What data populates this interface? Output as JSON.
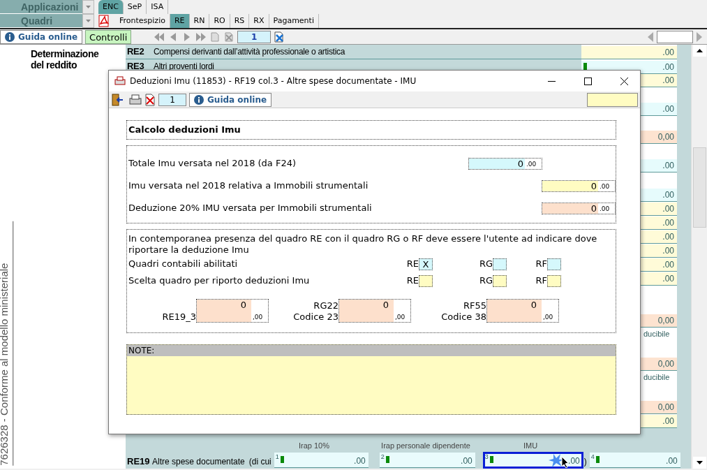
{
  "top_bar": {
    "applications_menu": "Applicazioni",
    "quadri_menu": "Quadri",
    "group_tabs": [
      {
        "label": "ENC",
        "selected": true
      },
      {
        "label": "SeP",
        "selected": false
      },
      {
        "label": "ISA",
        "selected": false
      }
    ],
    "quadro_tabs": [
      {
        "label": "Frontespizio",
        "selected": false
      },
      {
        "label": "RE",
        "selected": true
      },
      {
        "label": "RN",
        "selected": false
      },
      {
        "label": "RO",
        "selected": false
      },
      {
        "label": "RS",
        "selected": false
      },
      {
        "label": "RX",
        "selected": false
      },
      {
        "label": "Pagamenti",
        "selected": false
      }
    ]
  },
  "toolbar": {
    "help_button": "Guida online",
    "controls_button": "Controlli",
    "page_field": "1"
  },
  "sidebar": {
    "section_title": "Determinazione del reddito",
    "vertical_note": "7626328 - Conforme al modello ministeriale"
  },
  "form": {
    "rows": [
      {
        "code": "RE2",
        "label": "Compensi derivanti dall’attività professionale o artistica"
      },
      {
        "code": "RE3",
        "label": "Altri proventi lordi"
      }
    ],
    "side_fields": [
      {
        "kind": "field",
        "value": ".00",
        "color": "#fffbd8",
        "marker": false
      },
      {
        "kind": "field",
        "value": ".00",
        "color": "#e6fbfc",
        "marker": true
      },
      {
        "kind": "field",
        "value": ".00",
        "color": "#fffbd8",
        "marker": false
      },
      {
        "kind": "field",
        "value": ".00",
        "color": "#e6fbfc",
        "marker": false
      },
      {
        "kind": "field",
        "value": "0,00",
        "color": "#fde3d0",
        "marker": false
      },
      {
        "kind": "field",
        "value": ".00",
        "color": "#e6fbfc",
        "marker": false
      },
      {
        "kind": "field",
        "value": ".00",
        "color": "#e6fbfc",
        "marker": false
      },
      {
        "kind": "field",
        "value": ".00",
        "color": "#fffbd8",
        "marker": false
      },
      {
        "kind": "field",
        "value": ".00",
        "color": "#fffbd8",
        "marker": false
      },
      {
        "kind": "field",
        "value": ".00",
        "color": "#fffbd8",
        "marker": false
      },
      {
        "kind": "field",
        "value": ".00",
        "color": "#fffbd8",
        "marker": false
      },
      {
        "kind": "field",
        "value": ".00",
        "color": "#fffbd8",
        "marker": false
      },
      {
        "kind": "field",
        "value": ".00",
        "color": "#fffbd8",
        "marker": false
      },
      {
        "kind": "field",
        "value": "0,00",
        "color": "#fde3d0",
        "marker": false
      },
      {
        "kind": "label",
        "text": "ducibile"
      },
      {
        "kind": "field",
        "value": "0,00",
        "color": "#fde3d0",
        "marker": false
      },
      {
        "kind": "label",
        "text": "ducibile"
      },
      {
        "kind": "field",
        "value": "0,00",
        "color": "#fde3d0",
        "marker": false
      },
      {
        "kind": "field",
        "value": ".00",
        "color": "#fffbd8",
        "marker": false
      }
    ],
    "column_headers": [
      "Irap 10%",
      "Irap personale dipendente",
      "IMU"
    ],
    "re19": {
      "code": "RE19",
      "label": "Altre spese documentate",
      "note": "(di cui",
      "closing": ")",
      "fields": [
        {
          "number": "1",
          "value": ".00",
          "marker": true,
          "selected": false
        },
        {
          "number": "2",
          "value": ".00",
          "marker": true,
          "selected": false
        },
        {
          "number": "3",
          "value": ".00",
          "marker": true,
          "selected": true
        },
        {
          "number": "4",
          "value": ".00",
          "marker": true,
          "selected": false
        }
      ]
    }
  },
  "dialog": {
    "title": "Deduzioni Imu (11853) - RF19 col.3 - Altre spese documentate - IMU",
    "page_field": "1",
    "help_button": "Guida online",
    "section_title": "Calcolo deduzioni Imu",
    "amounts": [
      {
        "label": "Totale Imu versata nel 2018 (da F24)",
        "value": "0",
        "decimals": ".00",
        "color": "#d5f8fc"
      },
      {
        "label": "Imu versata nel 2018 relativa a Immobili strumentali",
        "value": "0",
        "decimals": ".00",
        "color": "#fffcc2"
      },
      {
        "label": "Deduzione 20% IMU versata per Immobili strumentali",
        "value": "0",
        "decimals": ".00",
        "color": "#fde0cc"
      }
    ],
    "info_text": "In contemporanea presenza del quadro RE con il quadro RG o RF deve essere l'utente ad indicare dove riportare la deduzione Imu",
    "check_glyph": "X",
    "choice_rows": [
      {
        "label": "Quadri contabili abilitati",
        "options": [
          {
            "label": "RE",
            "checked": true,
            "color": "#d5f8fc"
          },
          {
            "label": "RG",
            "checked": false,
            "color": "#d5f8fc"
          },
          {
            "label": "RF",
            "checked": false,
            "color": "#d5f8fc"
          }
        ]
      },
      {
        "label": "Scelta quadro per riporto deduzioni Imu",
        "options": [
          {
            "label": "RE",
            "checked": false,
            "color": "#fffcc2"
          },
          {
            "label": "RG",
            "checked": false,
            "color": "#fffcc2"
          },
          {
            "label": "RF",
            "checked": false,
            "color": "#fffcc2"
          }
        ]
      }
    ],
    "results": [
      {
        "lines": [
          "RE19_3"
        ],
        "value": "0",
        "decimals": ",00"
      },
      {
        "lines": [
          "RG22",
          "Codice 23"
        ],
        "value": "0",
        "decimals": ",00"
      },
      {
        "lines": [
          "RF55",
          "Codice 38"
        ],
        "value": "0",
        "decimals": ",00"
      }
    ],
    "notes_label": "NOTE:"
  }
}
